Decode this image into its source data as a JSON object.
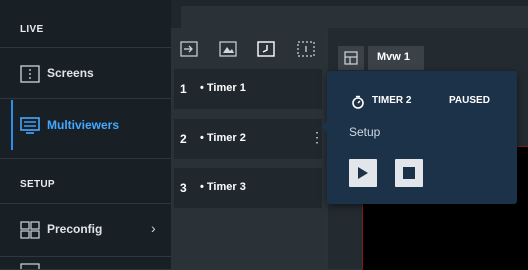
{
  "sidebar": {
    "live_label": "LIVE",
    "setup_label": "SETUP",
    "items": [
      {
        "label": "Screens",
        "icon": "screens-icon"
      },
      {
        "label": "Multiviewers",
        "icon": "multiviewer-icon",
        "active": true
      },
      {
        "label": "Preconfig",
        "icon": "preconfig-icon"
      }
    ]
  },
  "timers": [
    {
      "number": "1",
      "name": "• Timer 1"
    },
    {
      "number": "2",
      "name": "• Timer 2"
    },
    {
      "number": "3",
      "name": "• Timer 3"
    }
  ],
  "viewer": {
    "tab_label": "Mvw 1"
  },
  "popup": {
    "title": "TIMER 2",
    "status": "PAUSED",
    "setup_label": "Setup"
  },
  "colors": {
    "accent": "#45a8ff",
    "sidebar_bg": "#182026",
    "popup_bg": "#1c3248"
  }
}
